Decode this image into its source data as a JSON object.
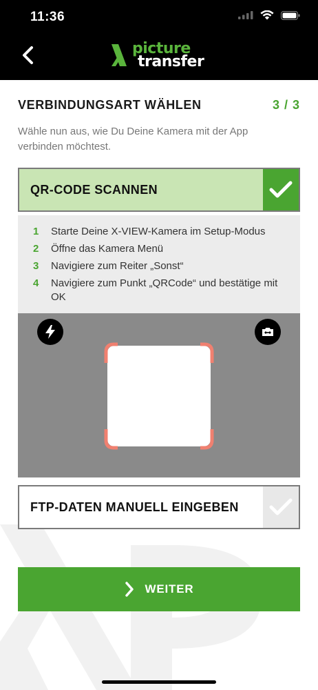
{
  "status_bar": {
    "time": "11:36"
  },
  "logo": {
    "word1": "picture",
    "word2": "transfer"
  },
  "page": {
    "title": "VERBINDUNGSART WÄHLEN",
    "step_count": "3 / 3",
    "subtitle": "Wähle nun aus, wie Du Deine Kamera mit der App verbinden möchtest."
  },
  "options": {
    "qr": {
      "label": "QR-CODE SCANNEN",
      "selected": true
    },
    "ftp": {
      "label": "FTP-DATEN MANUELL EINGEBEN",
      "selected": false
    }
  },
  "instructions": [
    {
      "num": "1",
      "text": "Starte Deine X-VIEW-Kamera im Setup-Modus"
    },
    {
      "num": "2",
      "text": "Öffne das Kamera Menü"
    },
    {
      "num": "3",
      "text": "Navigiere zum Reiter „Sonst“"
    },
    {
      "num": "4",
      "text": "Navigiere zum Punkt „QRCode“ und bestätige mit OK"
    }
  ],
  "camera": {
    "flash_icon": "flash-icon",
    "switch_icon": "camera-switch-icon"
  },
  "next_button": {
    "label": "WEITER"
  },
  "colors": {
    "accent": "#4aa531",
    "selected_bg": "#c9e5b4",
    "scan_frame": "#f08070",
    "header_bg": "#000000"
  }
}
